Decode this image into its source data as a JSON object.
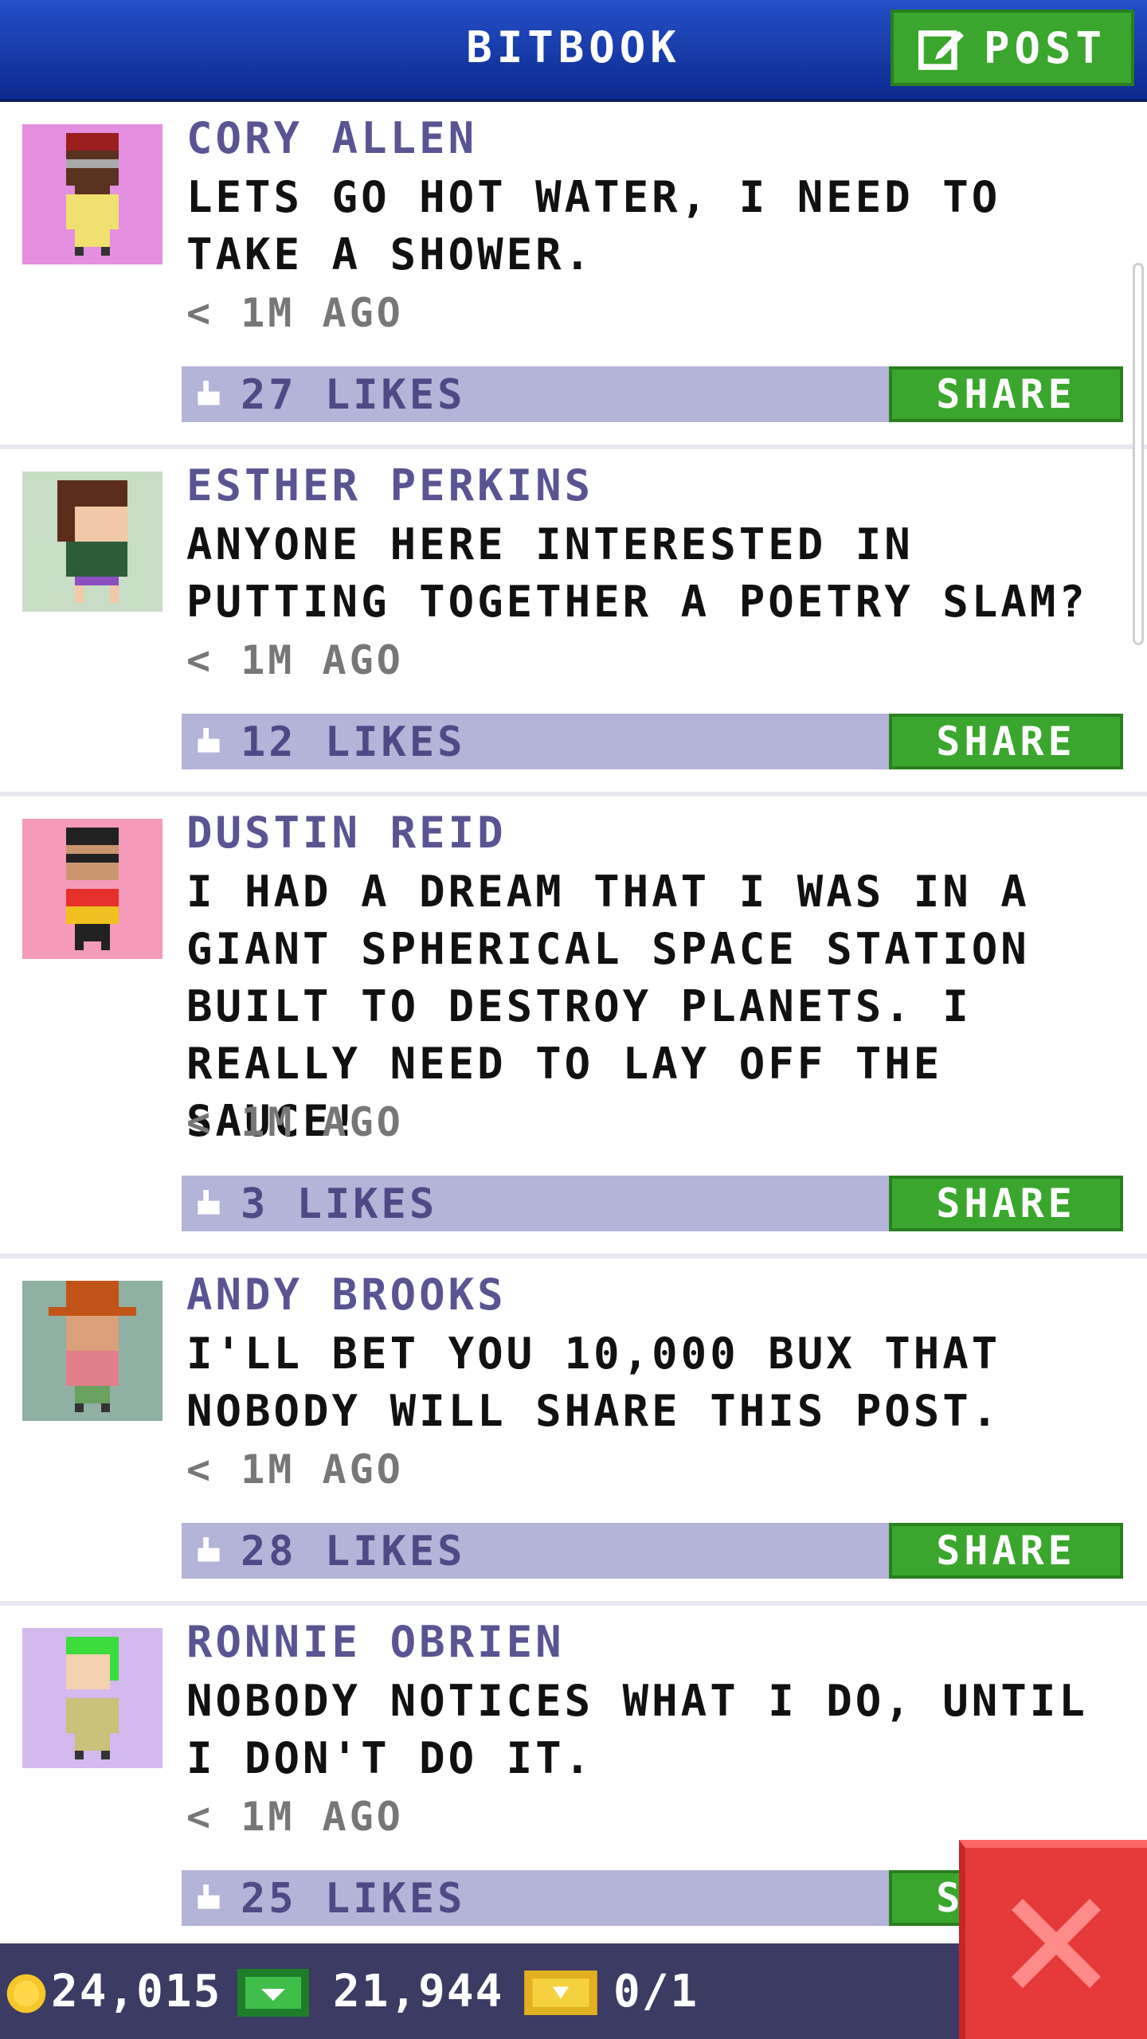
{
  "header": {
    "title": "BITBOOK",
    "post_label": "POST"
  },
  "posts": [
    {
      "author": "CORY ALLEN",
      "message": "LETS GO HOT WATER, I NEED TO TAKE A SHOWER.",
      "time": "< 1M AGO",
      "likes": "27 LIKES",
      "share_label": "SHARE",
      "avatar_bg": "#e58fe0"
    },
    {
      "author": "ESTHER PERKINS",
      "message": "ANYONE HERE INTERESTED IN PUTTING TOGETHER A POETRY SLAM?",
      "time": "< 1M AGO",
      "likes": "12 LIKES",
      "share_label": "SHARE",
      "avatar_bg": "#c9dcc6"
    },
    {
      "author": "DUSTIN REID",
      "message": "I HAD A DREAM THAT I WAS IN A GIANT SPHERICAL SPACE STATION BUILT TO DESTROY PLANETS. I REALLY NEED TO LAY OFF THE SAUCE!",
      "time": "< 1M AGO",
      "likes": "3 LIKES",
      "share_label": "SHARE",
      "avatar_bg": "#f59ab8"
    },
    {
      "author": "ANDY BROOKS",
      "message": "I'LL BET YOU 10,000 BUX THAT NOBODY WILL SHARE THIS POST.",
      "time": "< 1M AGO",
      "likes": "28 LIKES",
      "share_label": "SHARE",
      "avatar_bg": "#8fb0a2"
    },
    {
      "author": "RONNIE OBRIEN",
      "message": "NOBODY NOTICES WHAT I DO, UNTIL I DON'T DO IT.",
      "time": "< 1M AGO",
      "likes": "25 LIKES",
      "share_label": "SHARE",
      "avatar_bg": "#d4b9ee"
    }
  ],
  "status": {
    "coins": "24,015",
    "bux": "21,944",
    "tickets": "0/1"
  },
  "colors": {
    "header": "#1a3fb0",
    "share_green": "#3aa62d",
    "likes_bar": "#b4b4d8",
    "close_red": "#e63a3a"
  }
}
